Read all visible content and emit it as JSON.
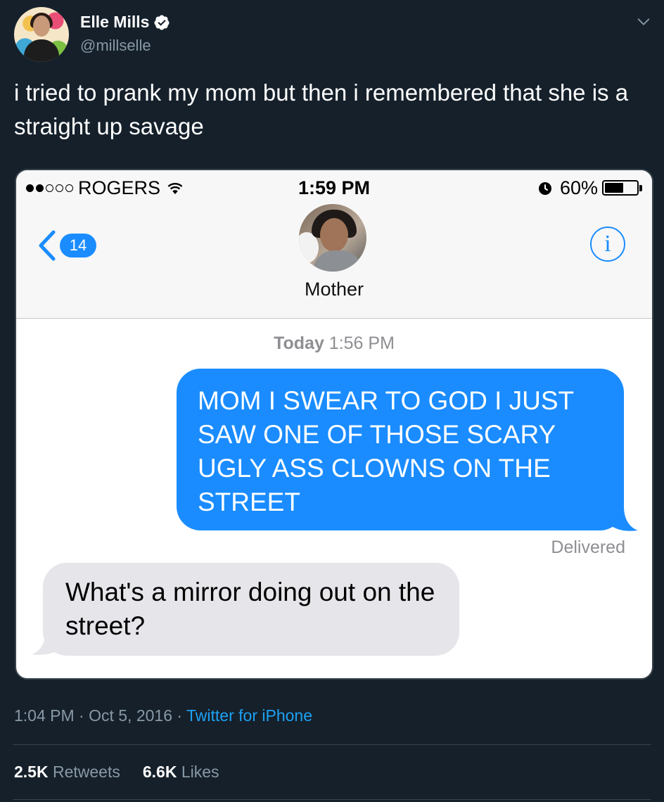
{
  "tweet": {
    "author_name": "Elle Mills",
    "handle": "@millselle",
    "text": "i tried to prank my mom but then i remembered that she is a straight up savage",
    "timestamp": "1:04 PM · Oct 5, 2016 · ",
    "source": "Twitter for iPhone",
    "retweets_count": "2.5K",
    "retweets_label": " Retweets",
    "likes_count": "6.6K",
    "likes_label": " Likes",
    "icons": [
      "verified-badge-icon",
      "chevron-down-icon"
    ]
  },
  "phone": {
    "status_bar": {
      "carrier": "ROGERS",
      "signal_bars_filled": 2,
      "signal_bars_total": 5,
      "time": "1:59 PM",
      "battery_text": "60%",
      "battery_level": 0.6
    },
    "nav": {
      "back_count": "14",
      "contact_name": "Mother",
      "info_glyph": "i"
    },
    "conversation": {
      "date_bold": "Today",
      "date_time": " 1:56 PM",
      "outgoing_message": "MOM I SWEAR TO GOD I JUST SAW ONE OF THOSE SCARY UGLY ASS CLOWNS ON THE STREET",
      "delivery_status": "Delivered",
      "incoming_message": "What's a mirror doing out on the street?"
    },
    "colors": {
      "imessage_blue": "#1a8cff",
      "incoming_gray": "#e5e5ea"
    }
  },
  "colors": {
    "background": "#15202b",
    "secondary_text": "#8899a6",
    "link": "#1da1f2"
  }
}
